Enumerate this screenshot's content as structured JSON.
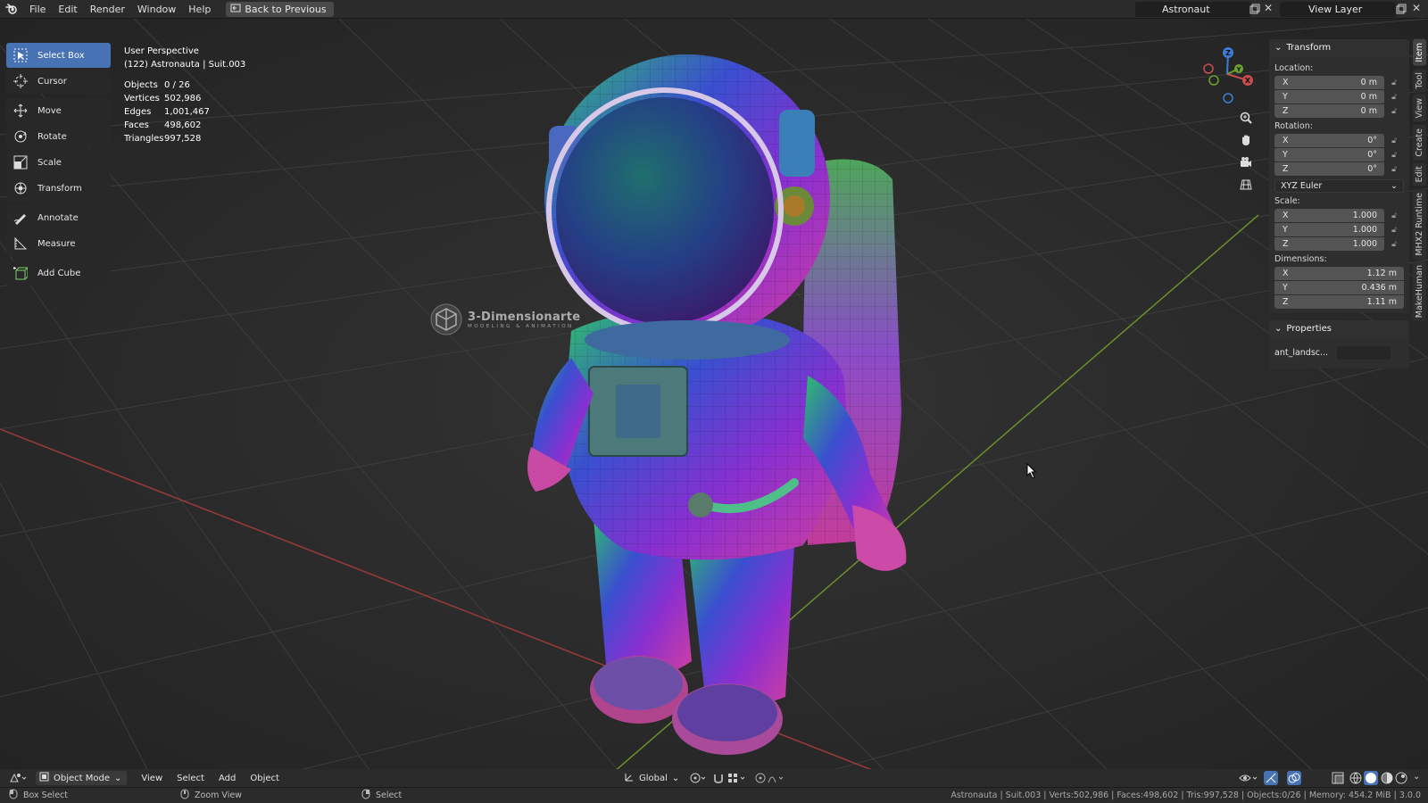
{
  "menubar": {
    "items": [
      "File",
      "Edit",
      "Render",
      "Window",
      "Help"
    ],
    "back_button": "Back to Previous",
    "scene": "Astronaut",
    "view_layer": "View Layer"
  },
  "toolbar": {
    "tools": [
      {
        "label": "Select Box",
        "icon": "select-box-icon",
        "active": true
      },
      {
        "label": "Cursor",
        "icon": "cursor-icon"
      },
      {
        "label": "Move",
        "icon": "move-icon"
      },
      {
        "label": "Rotate",
        "icon": "rotate-icon"
      },
      {
        "label": "Scale",
        "icon": "scale-icon"
      },
      {
        "label": "Transform",
        "icon": "transform-icon"
      },
      {
        "label": "Annotate",
        "icon": "annotate-icon"
      },
      {
        "label": "Measure",
        "icon": "measure-icon"
      },
      {
        "label": "Add Cube",
        "icon": "add-cube-icon"
      }
    ]
  },
  "viewport": {
    "perspective": "User Perspective",
    "object_info": "(122) Astronauta | Suit.003",
    "stats": [
      {
        "label": "Objects",
        "value": "0 / 26"
      },
      {
        "label": "Vertices",
        "value": "502,986"
      },
      {
        "label": "Edges",
        "value": "1,001,467"
      },
      {
        "label": "Faces",
        "value": "498,602"
      },
      {
        "label": "Triangles",
        "value": "997,528"
      }
    ],
    "watermark": {
      "title": "3-Dimensionarte",
      "subtitle": "MODELING & ANIMATION"
    },
    "gizmo_axes": [
      "X",
      "Y",
      "Z"
    ]
  },
  "npanel": {
    "transform_header": "Transform",
    "location_label": "Location:",
    "location": [
      {
        "axis": "X",
        "value": "0 m"
      },
      {
        "axis": "Y",
        "value": "0 m"
      },
      {
        "axis": "Z",
        "value": "0 m"
      }
    ],
    "rotation_label": "Rotation:",
    "rotation": [
      {
        "axis": "X",
        "value": "0°"
      },
      {
        "axis": "Y",
        "value": "0°"
      },
      {
        "axis": "Z",
        "value": "0°"
      }
    ],
    "rotation_mode": "XYZ Euler",
    "scale_label": "Scale:",
    "scale": [
      {
        "axis": "X",
        "value": "1.000"
      },
      {
        "axis": "Y",
        "value": "1.000"
      },
      {
        "axis": "Z",
        "value": "1.000"
      }
    ],
    "dimensions_label": "Dimensions:",
    "dimensions": [
      {
        "axis": "X",
        "value": "1.12 m"
      },
      {
        "axis": "Y",
        "value": "0.436 m"
      },
      {
        "axis": "Z",
        "value": "1.11 m"
      }
    ],
    "properties_header": "Properties",
    "property_name": "ant_landsc..."
  },
  "sidetabs": [
    "Item",
    "Tool",
    "View",
    "Create",
    "Edit",
    "MHX2 Runtime",
    "MakeHuman"
  ],
  "bottombar": {
    "mode": "Object Mode",
    "menus": [
      "View",
      "Select",
      "Add",
      "Object"
    ],
    "orientation": "Global"
  },
  "statusbar": {
    "left": [
      {
        "label": "Box Select"
      },
      {
        "label": "Zoom View"
      },
      {
        "label": "Select"
      }
    ],
    "right": "Astronauta | Suit.003 | Verts:502,986 | Faces:498,602 | Tris:997,528 | Objects:0/26 | Memory: 454.2 MiB | 3.0.0"
  },
  "colors": {
    "accent": "#4772b3",
    "x_axis": "#c84d4d",
    "y_axis": "#6ba32e",
    "z_axis": "#3d7dd8"
  }
}
